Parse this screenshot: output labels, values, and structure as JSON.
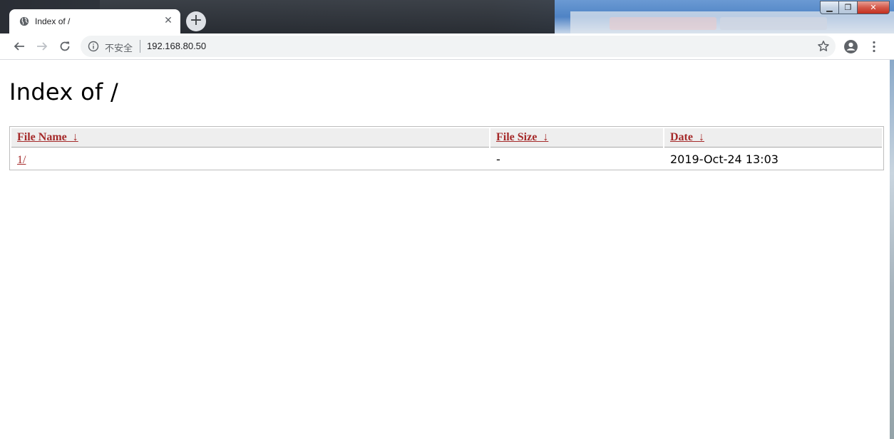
{
  "browser": {
    "tab": {
      "title": "Index of /",
      "close_glyph": "✕",
      "favicon": "globe-icon"
    },
    "new_tab_glyph": "+",
    "window_buttons": {
      "minimize": "▁",
      "maximize": "❐",
      "close": "✕"
    },
    "address_bar": {
      "security_label": "不安全",
      "url": "192.168.80.50"
    }
  },
  "page": {
    "heading": "Index of /",
    "table": {
      "headers": [
        {
          "label": "File Name  ↓"
        },
        {
          "label": "File Size  ↓"
        },
        {
          "label": "Date  ↓"
        }
      ],
      "rows": [
        {
          "name": "1/",
          "size": "-",
          "date": "2019-Oct-24 13:03"
        }
      ]
    }
  },
  "colors": {
    "link": "#a52a2a",
    "header_bg": "#eeeeee",
    "omnibox_bg": "#f1f3f4"
  }
}
